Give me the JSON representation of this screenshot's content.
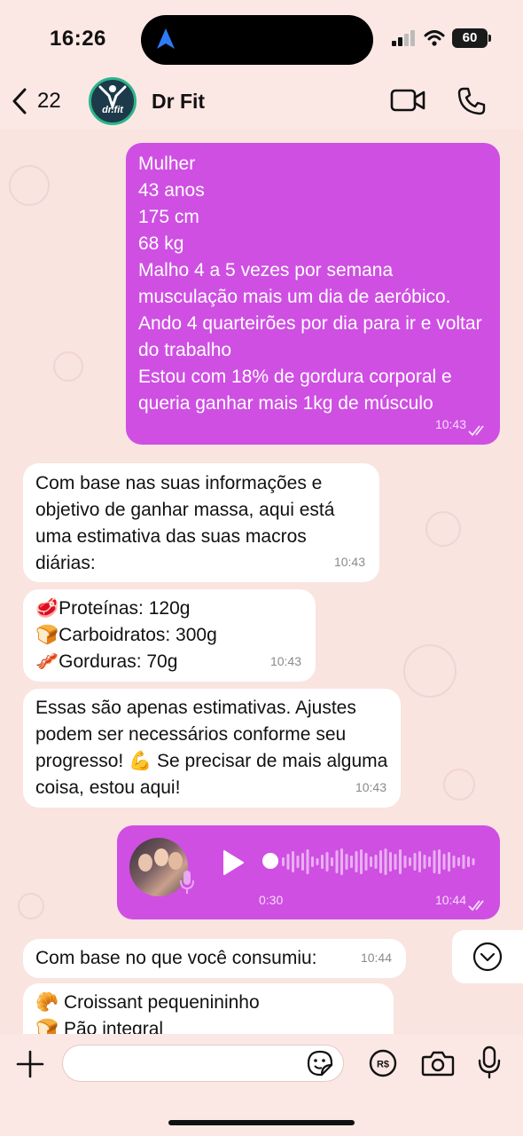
{
  "status_bar": {
    "time": "16:26",
    "battery": "60"
  },
  "header": {
    "back_count": "22",
    "contact_name": "Dr Fit",
    "avatar_text": "dr.fit"
  },
  "messages": {
    "m1": {
      "text": "Mulher\n43 anos\n175 cm\n68 kg\nMalho 4 a 5 vezes por semana musculação mais um dia de aeróbico.\nAndo 4 quarteirões por dia para ir e voltar do trabalho\nEstou com 18% de gordura corporal e queria ganhar mais 1kg de músculo",
      "time": "10:43"
    },
    "m2": {
      "text": "Com base nas suas informações e objetivo de ganhar massa, aqui está uma estimativa das suas macros diárias:",
      "time": "10:43"
    },
    "m3": {
      "lines": [
        "Proteínas: 120g",
        "Carboidratos: 300g",
        "Gorduras: 70g"
      ],
      "emojis": [
        "🥩",
        "🍞",
        "🥓"
      ],
      "time": "10:43"
    },
    "m4": {
      "text": "Essas são apenas estimativas. Ajustes podem ser necessários conforme seu progresso! 💪 Se precisar de mais alguma coisa, estou aqui!",
      "time": "10:43"
    },
    "m5": {
      "duration": "0:30",
      "time": "10:44",
      "progress": 0
    },
    "m6": {
      "text": "Com base no que você consumiu:",
      "time": "10:44"
    },
    "m7": {
      "lines": [
        "Croissant pequenininho",
        "Pão integral"
      ],
      "emojis": [
        "🥐",
        "🍞"
      ]
    }
  },
  "composer": {
    "placeholder": ""
  },
  "icons": [
    "back-chevron-icon",
    "video-call-icon",
    "phone-icon",
    "plus-icon",
    "sticker-icon",
    "payment-icon",
    "camera-icon",
    "microphone-icon",
    "play-icon",
    "read-ticks-icon",
    "scroll-down-icon",
    "location-arrow-icon",
    "signal-icon",
    "wifi-icon"
  ],
  "colors": {
    "outgoing_bubble": "#cf4fe3",
    "incoming_bubble": "#ffffff",
    "background": "#f9e4e0"
  }
}
